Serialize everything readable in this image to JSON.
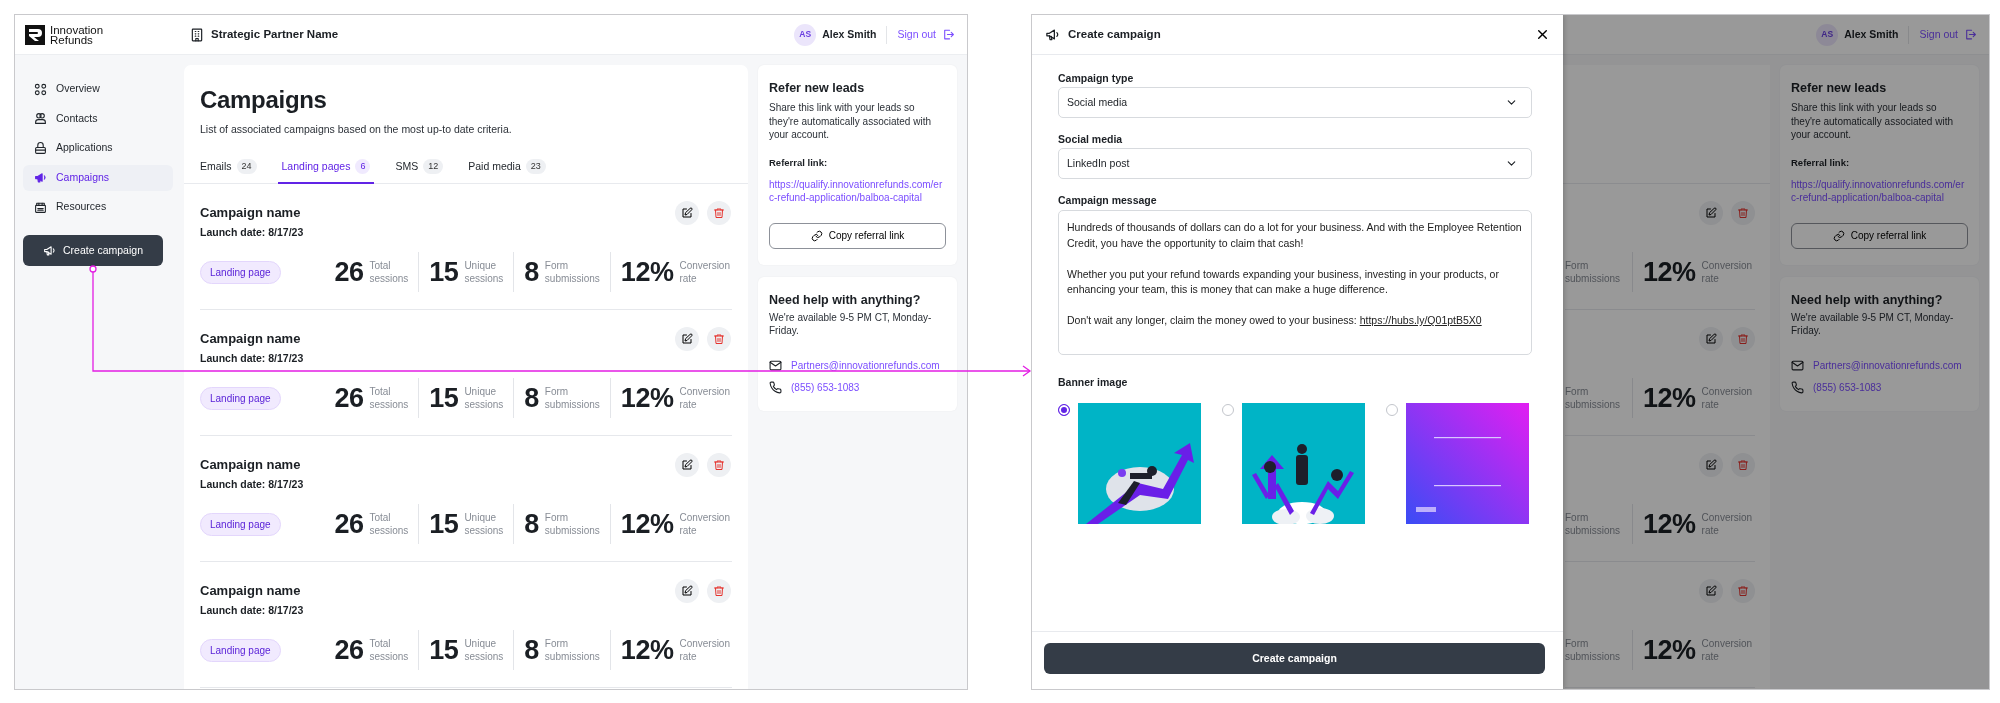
{
  "dashboard": {
    "logo_text": "Innovation Refunds",
    "partner": "Strategic Partner Name",
    "user": {
      "initials": "AS",
      "name": "Alex Smith"
    },
    "sign_out": "Sign out",
    "sidebar": {
      "items": [
        {
          "label": "Overview",
          "selected": false
        },
        {
          "label": "Contacts",
          "selected": false
        },
        {
          "label": "Applications",
          "selected": false
        },
        {
          "label": "Campaigns",
          "selected": true
        },
        {
          "label": "Resources",
          "selected": false
        }
      ],
      "button": "Create campaign"
    },
    "title": "Campaigns",
    "subtitle": "List of associated campaigns based on the most up-to date criteria.",
    "tabs": [
      {
        "label": "Emails",
        "count": "24",
        "selected": false
      },
      {
        "label": "Landing pages",
        "count": "6",
        "selected": true
      },
      {
        "label": "SMS",
        "count": "12",
        "selected": false
      },
      {
        "label": "Paid media",
        "count": "23",
        "selected": false
      }
    ],
    "campaigns": [
      {
        "name": "Campaign name",
        "launch": "Launch date: 8/17/23",
        "tag": "Landing page",
        "stats": [
          {
            "value": "26",
            "label": "Total sessions"
          },
          {
            "value": "15",
            "label": "Unique sessions"
          },
          {
            "value": "8",
            "label": "Form submissions"
          },
          {
            "value": "12%",
            "label": "Conversion rate"
          }
        ]
      },
      {
        "name": "Campaign name",
        "launch": "Launch date: 8/17/23",
        "tag": "Landing page",
        "stats": [
          {
            "value": "26",
            "label": "Total sessions"
          },
          {
            "value": "15",
            "label": "Unique sessions"
          },
          {
            "value": "8",
            "label": "Form submissions"
          },
          {
            "value": "12%",
            "label": "Conversion rate"
          }
        ]
      },
      {
        "name": "Campaign name",
        "launch": "Launch date: 8/17/23",
        "tag": "Landing page",
        "stats": [
          {
            "value": "26",
            "label": "Total sessions"
          },
          {
            "value": "15",
            "label": "Unique sessions"
          },
          {
            "value": "8",
            "label": "Form submissions"
          },
          {
            "value": "12%",
            "label": "Conversion rate"
          }
        ]
      },
      {
        "name": "Campaign name",
        "launch": "Launch date: 8/17/23",
        "tag": "Landing page",
        "stats": [
          {
            "value": "26",
            "label": "Total sessions"
          },
          {
            "value": "15",
            "label": "Unique sessions"
          },
          {
            "value": "8",
            "label": "Form submissions"
          },
          {
            "value": "12%",
            "label": "Conversion rate"
          }
        ]
      }
    ],
    "referral": {
      "title": "Refer new leads",
      "text": "Share this link with your leads so they're automatically associated with your account.",
      "link_label": "Referral link:",
      "link": "https://qualify.innovationrefunds.com/erc-refund-application/balboa-capital",
      "button": "Copy referral link"
    },
    "help": {
      "title": "Need help with anything?",
      "text": "We're available 9-5 PM CT, Monday-Friday.",
      "email": "Partners@innovationrefunds.com",
      "phone": "(855) 653-1083"
    }
  },
  "modal": {
    "title": "Create campaign",
    "selects": [
      {
        "label": "Campaign type",
        "value": "Social media"
      },
      {
        "label": "Social media",
        "value": "LinkedIn post"
      }
    ],
    "message_label": "Campaign message",
    "message": [
      {
        "text": "Hundreds of thousands of dollars can do a lot for your business. And with the Employee Retention Credit, you have the opportunity to claim that cash!"
      },
      {
        "text": "Whether you put your refund towards expanding your business, investing in your products, or enhancing your team, this is money that can make a huge difference."
      },
      {
        "text": "Don't wait any longer, claim the money owed to your business:",
        "link": "https://hubs.ly/Q01ptB5X0"
      }
    ],
    "banner_label": "Banner image",
    "banners": [
      {
        "kind": "picture",
        "selected": true
      },
      {
        "kind": "picture",
        "selected": false
      },
      {
        "kind": "picture",
        "selected": false
      }
    ],
    "submit": "Create campaign"
  },
  "background": {
    "user": {
      "initials": "AS",
      "name": "Alex Smith"
    },
    "sign_out": "Sign out",
    "rows": [
      {
        "cut_label": "Form submissions",
        "value": "12%",
        "label": "Conversion rate"
      },
      {
        "cut_label": "Form submissions",
        "value": "12%",
        "label": "Conversion rate"
      },
      {
        "cut_label": "Form submissions",
        "value": "12%",
        "label": "Conversion rate"
      },
      {
        "cut_label": "Form submissions",
        "value": "12%",
        "label": "Conversion rate"
      }
    ],
    "referral": {
      "title": "Refer new leads",
      "text": "Share this link with your leads so they're automatically associated with your account.",
      "link_label": "Referral link:",
      "link": "https://qualify.innovationrefunds.com/erc-refund-application/balboa-capital",
      "button": "Copy referral link"
    },
    "help": {
      "title": "Need help with anything?",
      "text": "We're available 9-5 PM CT, Monday-Friday.",
      "email": "Partners@innovationrefunds.com",
      "phone": "(855) 653-1083"
    }
  }
}
